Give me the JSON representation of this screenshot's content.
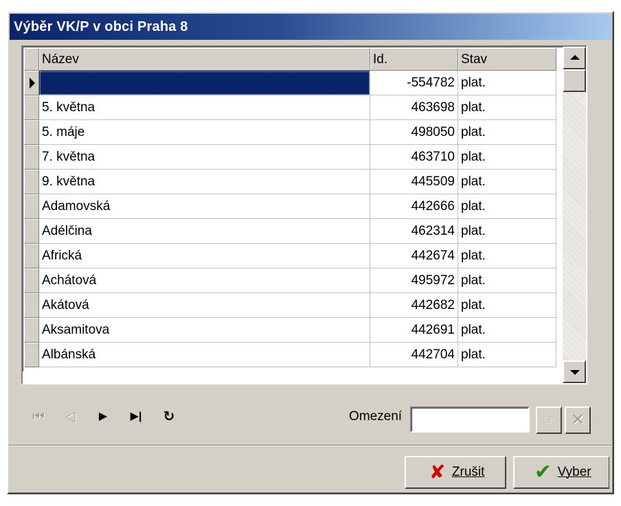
{
  "window": {
    "title": "Výběr VK/P v obci Praha 8"
  },
  "grid": {
    "columns": [
      "Název",
      "Id.",
      "Stav"
    ],
    "rows": [
      {
        "name": "",
        "id": "-554782",
        "status": "plat."
      },
      {
        "name": "5. května",
        "id": "463698",
        "status": "plat."
      },
      {
        "name": "5. máje",
        "id": "498050",
        "status": "plat."
      },
      {
        "name": "7. května",
        "id": "463710",
        "status": "plat."
      },
      {
        "name": "9. května",
        "id": "445509",
        "status": "plat."
      },
      {
        "name": "Adamovská",
        "id": "442666",
        "status": "plat."
      },
      {
        "name": "Adélčina",
        "id": "462314",
        "status": "plat."
      },
      {
        "name": "Africká",
        "id": "442674",
        "status": "plat."
      },
      {
        "name": "Achátová",
        "id": "495972",
        "status": "plat."
      },
      {
        "name": "Akátová",
        "id": "442682",
        "status": "plat."
      },
      {
        "name": "Aksamitova",
        "id": "442691",
        "status": "plat."
      },
      {
        "name": "Albánská",
        "id": "442704",
        "status": "plat."
      }
    ]
  },
  "navigator": {
    "first": "⏮",
    "prior": "◁",
    "next": "▶",
    "last": "▶|",
    "refresh": "↻"
  },
  "filter": {
    "label": "Omezení",
    "value": ""
  },
  "buttons": {
    "cancel": "Zrušit",
    "ok": "Vyber"
  },
  "icons": {
    "apply_filter": "☞",
    "clear_filter": "✕",
    "cancel": "✘",
    "ok": "✔"
  },
  "colors": {
    "title_start": "#0a246a",
    "title_end": "#a6caf0",
    "selection": "#0a246a",
    "face": "#d4d0c8"
  }
}
